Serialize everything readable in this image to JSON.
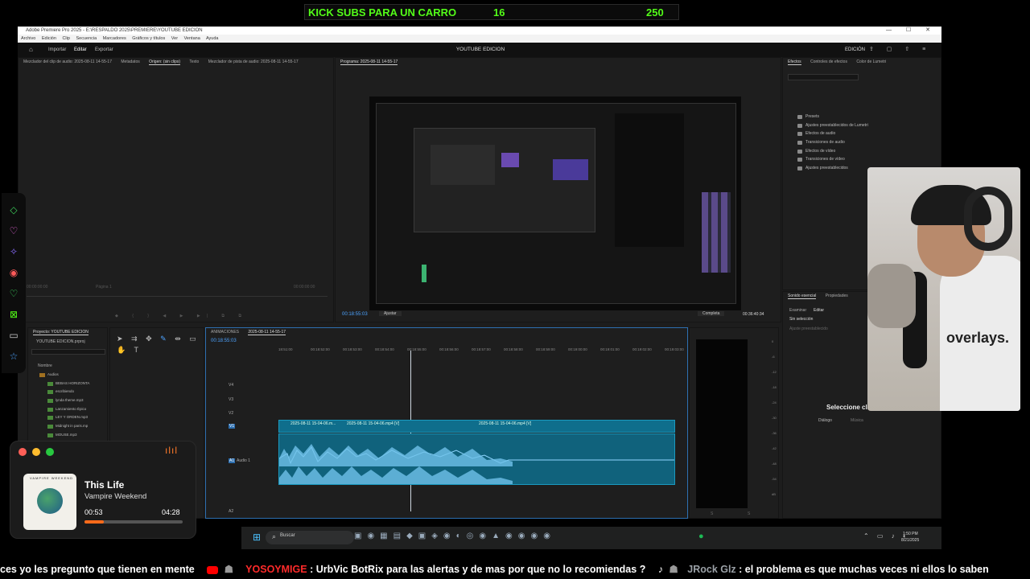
{
  "kick_bar": {
    "title": "KICK SUBS PARA UN CARRO",
    "current": "16",
    "goal": "250"
  },
  "window": {
    "title": "Adobe Premiere Pro 2025 - E:\\RESPALDO 2025\\PREMIERE\\YOUTUBE EDICION",
    "controls": "— ☐ ✕",
    "menu": [
      "Archivo",
      "Edición",
      "Clip",
      "Secuencia",
      "Marcadores",
      "Gráficos y títulos",
      "Ver",
      "Ventana",
      "Ayuda"
    ]
  },
  "workspace": {
    "tabs": [
      "Importar",
      "Editar",
      "Exportar"
    ],
    "active_tab": "Editar",
    "title": "YOUTUBE EDICION",
    "right_label": "EDICIÓN"
  },
  "source_panel": {
    "tabs": [
      "Mezclador del clip de audio: 2025-08-11 14-55-17",
      "Metadatos",
      "Origen: (sin clips)",
      "Texto",
      "Mezclador de pista de audio: 2025-08-11 14-55-17"
    ],
    "left_timecode": "00:00:00:00",
    "page_label": "Página 1",
    "right_timecode": "00:00:00:00"
  },
  "program_panel": {
    "tab": "Programa: 2025-08-11 14-55-17",
    "timecode": "00:18:55:03",
    "fit": "Ajustar",
    "quality": "Completa",
    "duration": "00:36:40:34"
  },
  "effects_panel": {
    "tabs": [
      "Efectos",
      "Controles de efectos",
      "Color de Lumetri"
    ],
    "items": [
      "Presets",
      "Ajustes preestablecidos de Lumetri",
      "Efectos de audio",
      "Transiciones de audio",
      "Efectos de vídeo",
      "Transiciones de vídeo",
      "Ajustes preestablecidos"
    ]
  },
  "essential_sound": {
    "tabs": [
      "Sonido esencial",
      "Propiedades"
    ],
    "subtabs": [
      "Examinar",
      "Editar"
    ],
    "no_selection": "Sin selección",
    "preset_label": "Ajuste preestablecido",
    "select_clips": "Seleccione clips",
    "dialog": "Diálogo",
    "music": "Música"
  },
  "project_panel": {
    "tab": "Proyecto: YOUTUBE EDICION",
    "file": "YOUTUBE EDICION.prproj",
    "column": "Nombre",
    "items": [
      "Audios",
      "BEBAS HORIZONTA",
      "escribiendo",
      "lynda theme.mp3",
      "Lanzamiento Épico",
      "LEY Y ORDEN.mp3",
      "Midnight in paris.mp",
      "MOUSE.mp3"
    ]
  },
  "timeline": {
    "tabs": [
      "ANIMACIONES",
      "2025-08-11 14-55-17"
    ],
    "timecode": "00:18:55:03",
    "ruler": [
      "18:51:00",
      "00:18:52:00",
      "00:18:53:00",
      "00:18:54:00",
      "00:18:55:00",
      "00:18:56:00",
      "00:18:57:00",
      "00:18:58:00",
      "00:18:59:00",
      "00:19:00:00",
      "00:19:01:00",
      "00:19:02:00",
      "00:19:03:00"
    ],
    "tracks": [
      "V4",
      "V3",
      "V2",
      "V1",
      "A1",
      "A2"
    ],
    "audio_track_name": "Audio 1",
    "clips": [
      "2025-08-11 15-04-06.m...",
      "2025-08-11 15-04-06.mp4 [V]",
      "2025-08-11 15-04-06.mp4 [V]"
    ]
  },
  "meter": {
    "labels": [
      "0",
      "-6",
      "-12",
      "-18",
      "-24",
      "-30",
      "-36",
      "-42",
      "-48",
      "-54",
      "dB"
    ],
    "bottom": [
      "S",
      "S"
    ]
  },
  "music_widget": {
    "song": "This Life",
    "artist": "Vampire Weekend",
    "elapsed": "00:53",
    "total": "04:28",
    "progress": 0.2,
    "album_text": "VAMPIRE WEEKEND"
  },
  "taskbar": {
    "search": "Buscar",
    "time": "1:50 PM",
    "date": "8/21/2025"
  },
  "ticker": {
    "lead": "ces yo les pregunto que tienen en mente",
    "user1": "YOSOYMIGE",
    "msg1": ": UrbVic BotRix para las alertas y de mas por que no lo recomiendas ?",
    "user2": "JRock Glz",
    "msg2": ": el problema es que muchas veces ni ellos lo saben"
  },
  "webcam": {
    "shirt_text": "overlays."
  },
  "colors": {
    "kick_green": "#53fc18",
    "accent_blue": "#2d8ceb",
    "clip_teal": "#0f6e8c",
    "yt_red": "#ff0000"
  }
}
